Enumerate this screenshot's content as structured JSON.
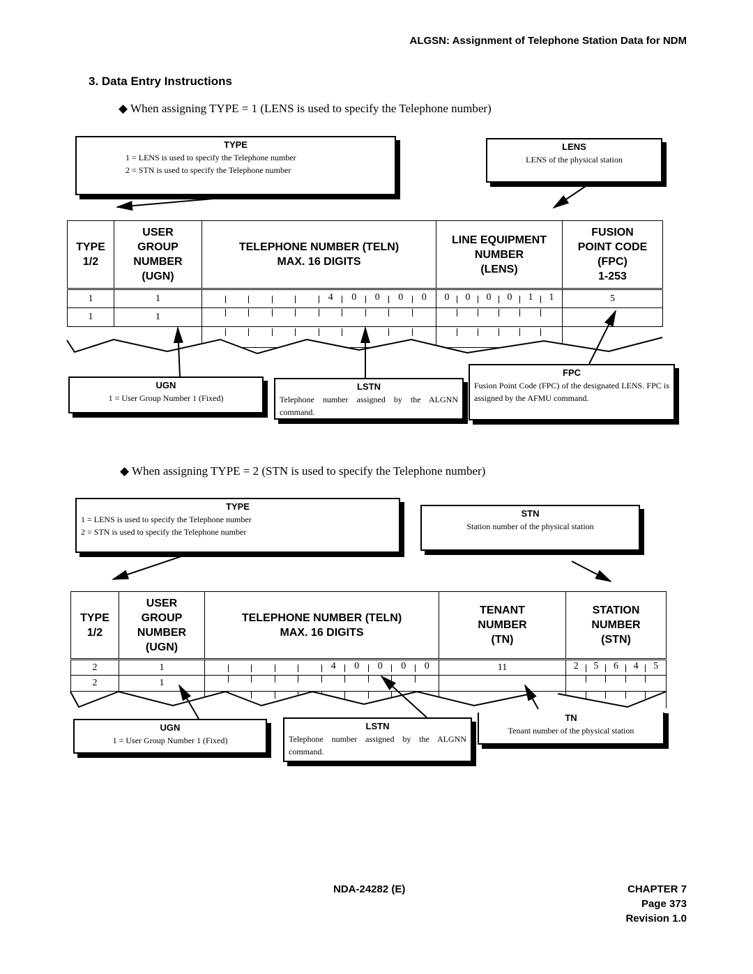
{
  "header": {
    "title": "ALGSN: Assignment of Telephone Station Data for NDM"
  },
  "section": {
    "title": "3.   Data Entry Instructions"
  },
  "part1": {
    "bullet": "When assigning TYPE = 1 (LENS is used to specify the Telephone number)",
    "type_box": {
      "title": "TYPE",
      "lines": [
        "1 = LENS is used to specify the Telephone number",
        "2 = STN is used to specify the Telephone number"
      ]
    },
    "lens_box": {
      "title": "LENS",
      "text": "LENS of the physical station"
    },
    "table": {
      "headers": [
        [
          "TYPE",
          "1/2"
        ],
        [
          "USER",
          "GROUP",
          "NUMBER",
          "(UGN)"
        ],
        [
          "TELEPHONE NUMBER (TELN)",
          "MAX. 16 DIGITS"
        ],
        [
          "LINE EQUIPMENT",
          "NUMBER",
          "(LENS)"
        ],
        [
          "FUSION",
          "POINT CODE",
          "(FPC)",
          "1-253"
        ]
      ],
      "rows": [
        {
          "type": "1",
          "ugn": "1",
          "teln": [
            "",
            "",
            "",
            "",
            "",
            "4",
            "0",
            "0",
            "0",
            "0"
          ],
          "lens": [
            "0",
            "0",
            "0",
            "0",
            "1",
            "1"
          ],
          "fpc": "5"
        },
        {
          "type": "1",
          "ugn": "1",
          "teln": [
            "",
            "",
            "",
            "",
            "",
            "",
            "",
            "",
            "",
            ""
          ],
          "lens": [
            "",
            "",
            "",
            "",
            "",
            ""
          ],
          "fpc": ""
        }
      ]
    },
    "ugn_box": {
      "title": "UGN",
      "text": "1 = User Group Number 1 (Fixed)"
    },
    "lstn_box": {
      "title": "LSTN",
      "text": "Telephone number assigned by the ALGNN command."
    },
    "fpc_box": {
      "title": "FPC",
      "text": "Fusion Point Code (FPC) of the designated LENS. FPC is assigned by the AFMU command."
    }
  },
  "part2": {
    "bullet": "When assigning TYPE = 2 (STN is used to specify the Telephone number)",
    "type_box": {
      "title": "TYPE",
      "lines": [
        "1 = LENS is used to specify the Telephone number",
        "2 = STN is used to specify the Telephone number"
      ]
    },
    "stn_box": {
      "title": "STN",
      "text": "Station number of the physical station"
    },
    "table": {
      "headers": [
        [
          "TYPE",
          "1/2"
        ],
        [
          "USER",
          "GROUP",
          "NUMBER",
          "(UGN)"
        ],
        [
          "TELEPHONE NUMBER (TELN)",
          "MAX. 16 DIGITS"
        ],
        [
          "TENANT",
          "NUMBER",
          "(TN)"
        ],
        [
          "STATION",
          "NUMBER",
          "(STN)"
        ]
      ],
      "rows": [
        {
          "type": "2",
          "ugn": "1",
          "teln": [
            "",
            "",
            "",
            "",
            "",
            "4",
            "0",
            "0",
            "0",
            "0"
          ],
          "tn": "11",
          "stn": [
            "2",
            "5",
            "6",
            "4",
            "5"
          ]
        },
        {
          "type": "2",
          "ugn": "1",
          "teln": [
            "",
            "",
            "",
            "",
            "",
            "",
            "",
            "",
            "",
            ""
          ],
          "tn": "",
          "stn": [
            "",
            "",
            "",
            "",
            ""
          ]
        }
      ]
    },
    "ugn_box": {
      "title": "UGN",
      "text": "1 = User Group Number 1 (Fixed)"
    },
    "lstn_box": {
      "title": "LSTN",
      "text": "Telephone number assigned by the ALGNN command."
    },
    "tn_box": {
      "title": "TN",
      "text": "Tenant number of the physical station"
    }
  },
  "footer": {
    "doc": "NDA-24282 (E)",
    "chapter": "CHAPTER 7",
    "page": "Page 373",
    "revision": "Revision 1.0"
  },
  "icons": {
    "bullet": "black-diamond-bullet"
  }
}
